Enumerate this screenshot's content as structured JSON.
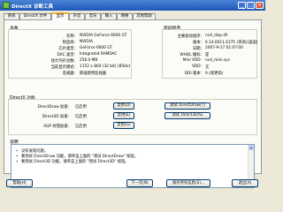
{
  "window": {
    "title": "DirectX 诊断工具",
    "min_glyph": "_",
    "max_glyph": "□",
    "close_glyph": "×"
  },
  "tabs": [
    {
      "label": "系统"
    },
    {
      "label": "DirectX 文件"
    },
    {
      "label": "显示"
    },
    {
      "label": "声音"
    },
    {
      "label": "音乐"
    },
    {
      "label": "输入"
    },
    {
      "label": "网络"
    },
    {
      "label": "其他帮助"
    }
  ],
  "device": {
    "title": "设备",
    "fields": [
      {
        "label": "名称:",
        "value": "NVIDIA GeForce 6600 GT"
      },
      {
        "label": "制造商:",
        "value": "NVIDIA"
      },
      {
        "label": "芯片类型:",
        "value": "GeForce 6600 GT"
      },
      {
        "label": "DAC 类型:",
        "value": "Integrated RAMDAC"
      },
      {
        "label": "估计内存总数:",
        "value": "256.0 MB"
      },
      {
        "label": "当前显示模式:",
        "value": "1152 x 864 (32 bit) (85Hz)"
      },
      {
        "label": "监视器:",
        "value": "即插即用监视器"
      }
    ]
  },
  "driver": {
    "title": "驱动程序",
    "fields": [
      {
        "label": "主要驱动程序:",
        "value": "nv4_disp.dll"
      },
      {
        "label": "版本:",
        "value": "6.14.0011.6375 (英语)(美国)"
      },
      {
        "label": "日期:",
        "value": "2007-9-17 01:07:00"
      },
      {
        "label": "WHQL 徽标:",
        "value": "是"
      },
      {
        "label": "Mini VDD:",
        "value": "nv4_mini.sys"
      },
      {
        "label": "VDD:",
        "value": "无"
      },
      {
        "label": "DDI 版本:",
        "value": "9 (或更高)"
      }
    ]
  },
  "features": {
    "title": "DirectX 功能",
    "rows": [
      {
        "label": "DirectDraw 加速:",
        "status": "已启用",
        "disable": "禁用(D)",
        "test": "测试 DirectDraw(T)"
      },
      {
        "label": "Direct3D 加速:",
        "status": "已启用",
        "disable": "禁用(E)",
        "test": "测试 Direct3D(S)"
      },
      {
        "label": "AGP 纹理加速:",
        "status": "已启用",
        "disable": "禁用(G)",
        "test": ""
      }
    ]
  },
  "notes": {
    "title": "说明",
    "lines": [
      "没有发现问题。",
      "要测试 DirectDraw 功能，请单击上面的 \"测试 DirectDraw\" 按钮。",
      "要测试 Direct3D 功能，请单击上面的 \"测试 Direct3D\" 按钮。"
    ],
    "bullet": "•"
  },
  "footer": {
    "help": "帮助(H)",
    "next": "下一页(N)",
    "save": "保存所有信息(S)...",
    "exit": "退出(X)"
  },
  "colors": {
    "titlebar": "#1f57b8",
    "tab_highlight": "#f3b33f",
    "background": "#ece9d8"
  }
}
